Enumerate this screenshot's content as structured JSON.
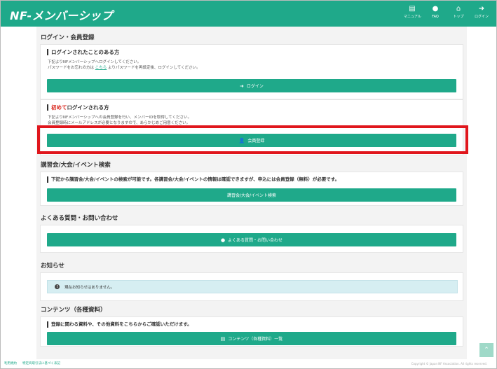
{
  "header": {
    "logo": "NF-メンバーシップ",
    "nav": [
      {
        "icon": "book-icon",
        "glyph": "▤",
        "label": "マニュアル"
      },
      {
        "icon": "chat-icon",
        "glyph": "●",
        "label": "FAQ"
      },
      {
        "icon": "home-icon",
        "glyph": "⌂",
        "label": "トップ"
      },
      {
        "icon": "login-icon",
        "glyph": "➜",
        "label": "ログイン"
      }
    ]
  },
  "login_section": {
    "title": "ログイン・会員登録",
    "returning": {
      "heading": "ログインされたことのある方",
      "desc_line1": "下記よりNFメンバーシップへログインしてください。",
      "desc_line2_pre": "パスワードをお忘れの方は",
      "desc_link": "こちら",
      "desc_line2_post": "よりパスワードを再設定後、ログインしてください。",
      "button": "ログイン"
    },
    "first_time": {
      "heading_red": "初めて",
      "heading_rest": "ログインされる方",
      "desc_line1": "下記よりNFメンバーシップへの会員登録を行い、メンバーIDを取得してください。",
      "desc_line2": "会員登録時にメールアドレスが必要となりますので、あらかじめご用意ください。",
      "button": "会員登録"
    }
  },
  "events_section": {
    "title": "講習会/大会/イベント検索",
    "heading": "下記から講習会/大会/イベントの検索が可能です。各講習会/大会/イベントの情報は確認できますが、申込には会員登録（無料）が必要です。",
    "button": "講習会/大会/イベント検索"
  },
  "faq_section": {
    "title": "よくある質問・お問い合わせ",
    "button": "よくある質問・お問い合わせ"
  },
  "news_section": {
    "title": "お知らせ",
    "message": "現在お知らせはありません。"
  },
  "contents_section": {
    "title": "コンテンツ（各種資料）",
    "heading": "登録に関わる資料や、その他資料をこちらからご確認いただけます。",
    "button": "コンテンツ（各種資料）一覧"
  },
  "footer": {
    "link_terms": "利用規約",
    "link_law": "特定商取引法に基づく表記",
    "copyright": "Copyright © Japan NF Association. All rights reserved."
  },
  "colors": {
    "accent": "#1fa98a",
    "highlight": "#e0161c"
  }
}
